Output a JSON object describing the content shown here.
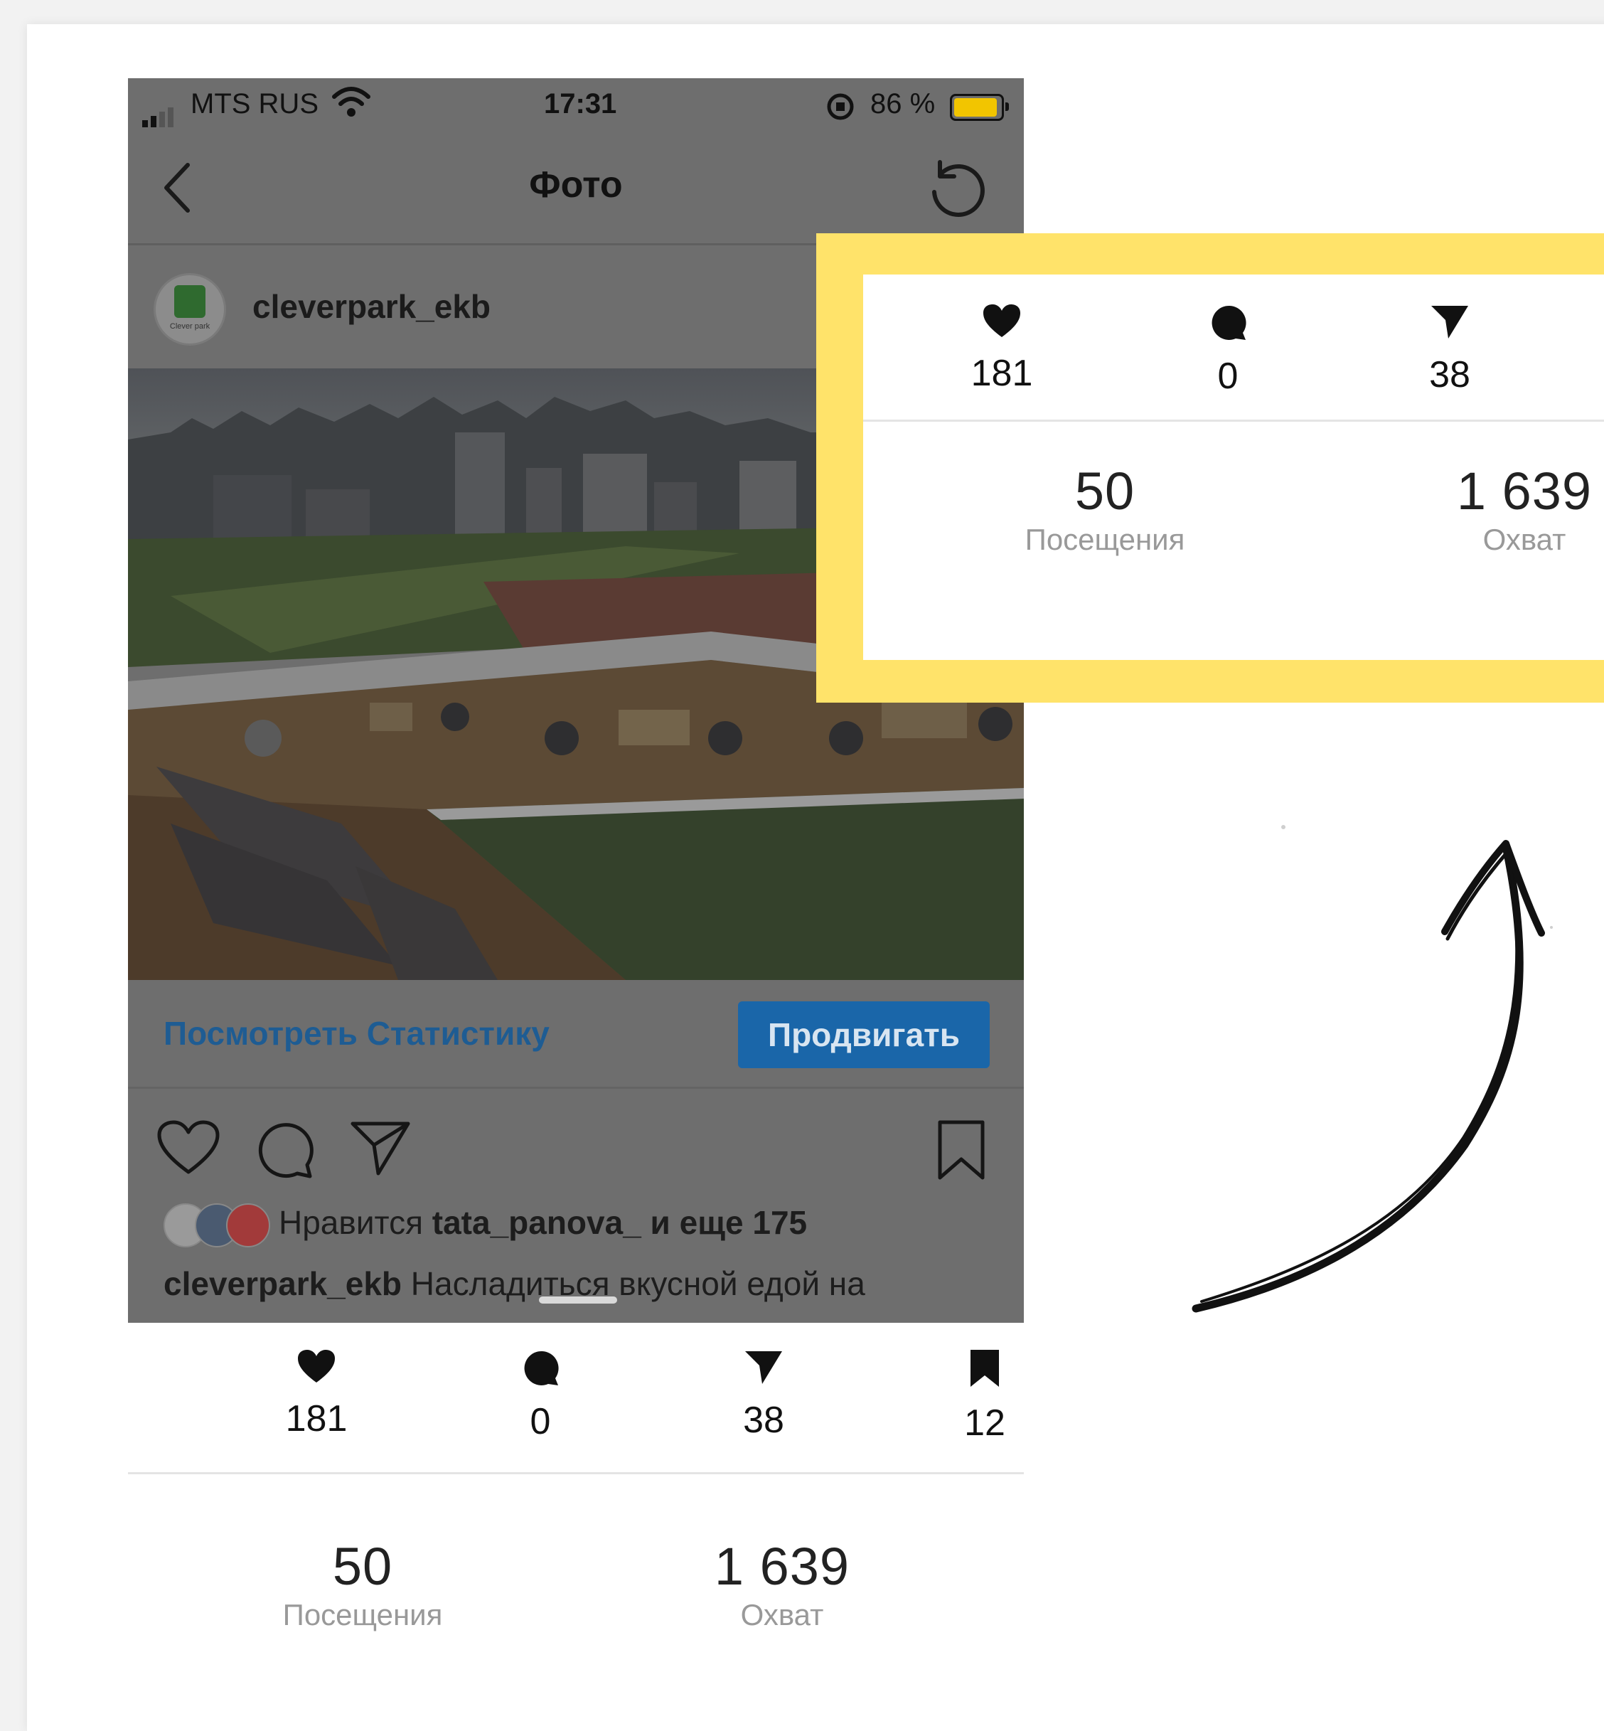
{
  "status_bar": {
    "carrier": "MTS RUS",
    "time": "17:31",
    "battery_percent": "86 %",
    "battery_level": 0.86
  },
  "nav": {
    "title": "Фото"
  },
  "post": {
    "username": "cleverpark_ekb",
    "avatar_brand": "Clever park",
    "view_stats_label": "Посмотреть Статистику",
    "promote_label": "Продвигать",
    "likes_prefix": "Нравится ",
    "likes_user": "tata_panova_",
    "likes_suffix": " и еще 175",
    "caption_user": "cleverpark_ekb",
    "caption_text": " Насладиться вкусной едой на"
  },
  "stats": {
    "likes": "181",
    "comments": "0",
    "shares": "38",
    "saves": "12",
    "visits_value": "50",
    "visits_label": "Посещения",
    "reach_value": "1 639",
    "reach_label": "Охват"
  },
  "colors": {
    "accent_blue": "#1a66a9",
    "link_blue": "#1e5c93",
    "highlight_yellow": "#ffe36a",
    "battery_yellow": "#f2c500"
  },
  "icons": {
    "like": "heart-icon",
    "comment": "comment-bubble-icon",
    "share": "paper-plane-icon",
    "save": "bookmark-icon",
    "back": "chevron-left-icon",
    "refresh": "refresh-icon"
  }
}
